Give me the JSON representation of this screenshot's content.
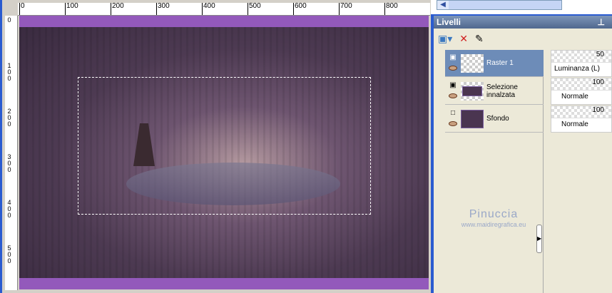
{
  "rulers": {
    "horizontal": [
      "0",
      "100",
      "200",
      "300",
      "400",
      "500",
      "600",
      "700",
      "800"
    ],
    "vertical": [
      "0",
      "100",
      "200",
      "300",
      "400",
      "500"
    ]
  },
  "panel": {
    "title": "Livelli",
    "watermark": {
      "name": "Pinuccia",
      "url": "www.maidiregrafica.eu"
    }
  },
  "layers": [
    {
      "name": "Raster 1",
      "opacity": "50",
      "blend": "Luminanza (L)",
      "selected": true
    },
    {
      "name": "Selezione innalzata",
      "opacity": "100",
      "blend": "Normale",
      "selected": false
    },
    {
      "name": "Sfondo",
      "opacity": "100",
      "blend": "Normale",
      "selected": false
    }
  ],
  "colors": {
    "canvas_border": "#9359bb",
    "selected_layer": "#6d8cb8"
  }
}
